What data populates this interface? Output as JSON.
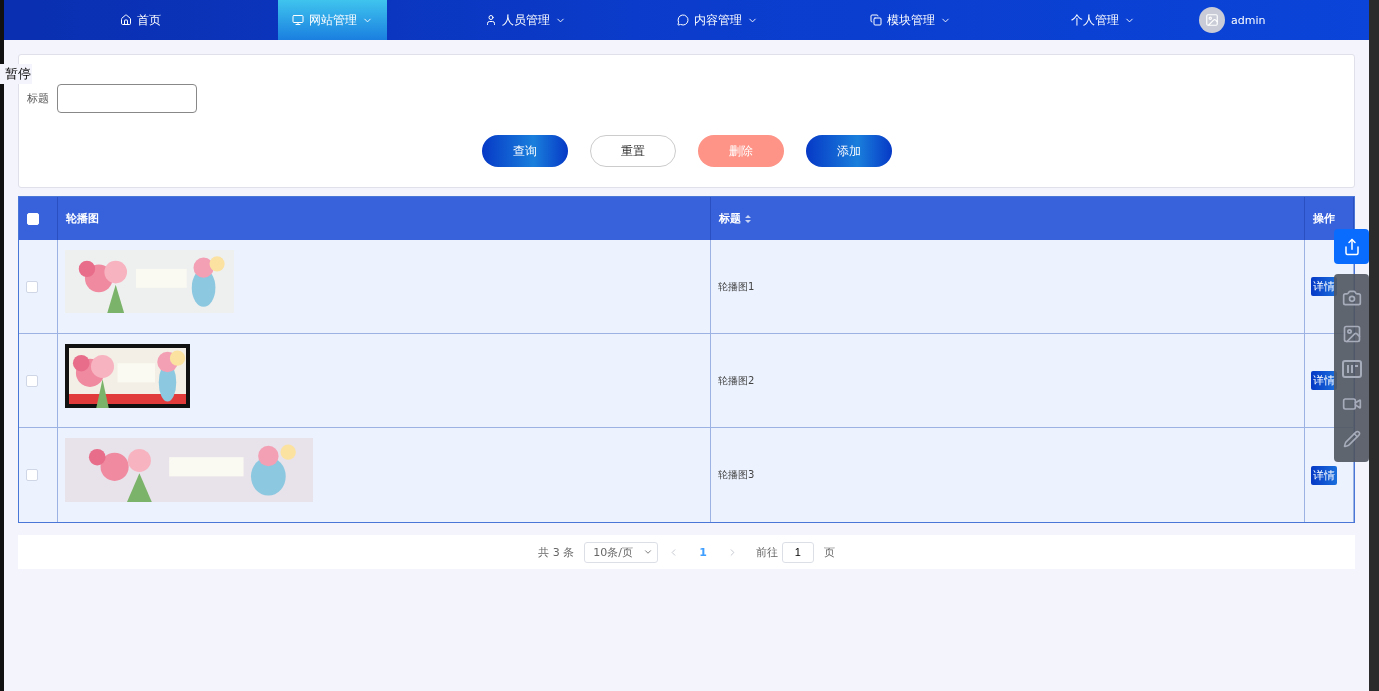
{
  "nav": {
    "items": [
      {
        "label": "首页",
        "selected": false
      },
      {
        "label": "网站管理",
        "selected": true
      },
      {
        "label": "人员管理",
        "selected": false
      },
      {
        "label": "内容管理",
        "selected": false
      },
      {
        "label": "模块管理",
        "selected": false
      },
      {
        "label": "个人管理",
        "selected": false
      }
    ],
    "user": {
      "name": "admin"
    }
  },
  "overlay_text": "暂停",
  "search": {
    "label": "标题",
    "buttons": [
      {
        "label": "查询",
        "kind": "primary"
      },
      {
        "label": "重置",
        "kind": "plain"
      },
      {
        "label": "删除",
        "kind": "danger"
      },
      {
        "label": "添加",
        "kind": "primary"
      }
    ]
  },
  "table": {
    "select_all": {
      "checked": false
    },
    "columns": [
      {
        "label": "轮播图"
      },
      {
        "label": "标题"
      },
      {
        "label": "操作"
      }
    ],
    "rows": [
      {
        "checked": false,
        "title": "轮播图1",
        "action": "详情"
      },
      {
        "checked": false,
        "title": "轮播图2",
        "action": "详情"
      },
      {
        "checked": false,
        "title": "轮播图3",
        "action": "详情"
      }
    ]
  },
  "pagination": {
    "total": "共 3 条",
    "page_size": "10条/页",
    "pages": [
      {
        "label": "1",
        "selected": true
      }
    ],
    "goto_label": "前往",
    "goto_value": "1",
    "goto_suffix": "页"
  }
}
